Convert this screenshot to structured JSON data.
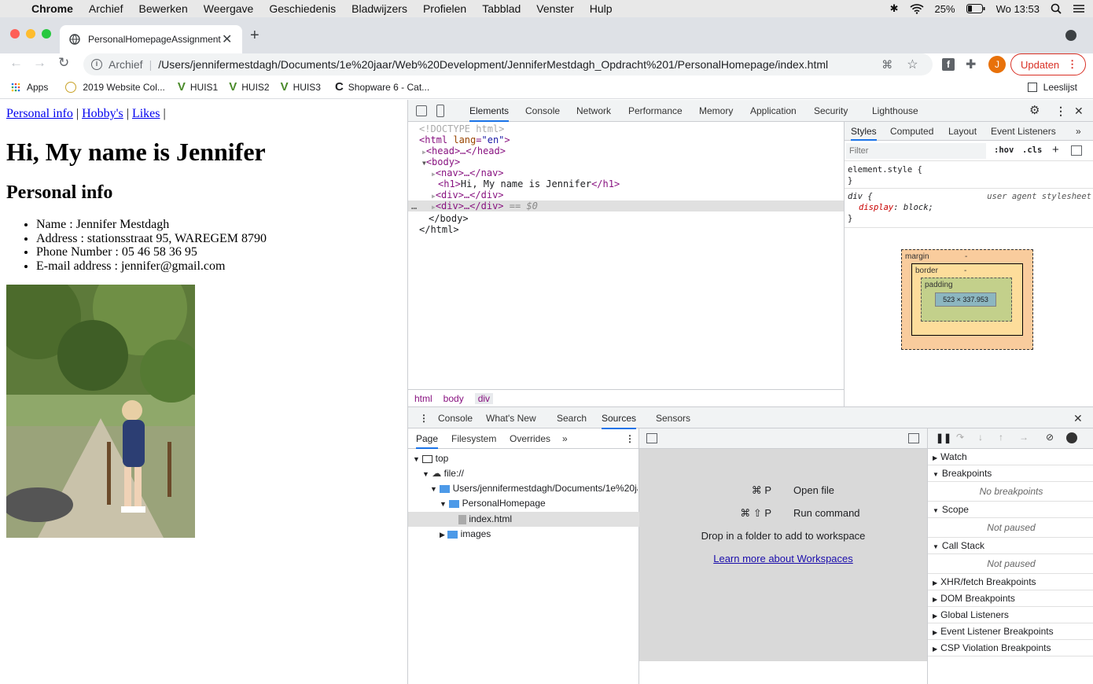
{
  "menubar": {
    "app": "Chrome",
    "items": [
      "Archief",
      "Bewerken",
      "Weergave",
      "Geschiedenis",
      "Bladwijzers",
      "Profielen",
      "Tabblad",
      "Venster",
      "Hulp"
    ],
    "battery": "25%",
    "clock": "Wo 13:53"
  },
  "tab": {
    "title": "PersonalHomepageAssignment"
  },
  "address": {
    "prefix": "Archief",
    "url": "/Users/jennifermestdagh/Documents/1e%20jaar/Web%20Development/JenniferMestdagh_Opdracht%201/PersonalHomepage/index.html"
  },
  "profile": {
    "initial": "J",
    "update_label": "Updaten"
  },
  "bookmarks": {
    "items": [
      "Apps",
      "2019 Website Col...",
      "HUIS1",
      "HUIS2",
      "HUIS3",
      "Shopware 6 - Cat..."
    ],
    "reading_list": "Leeslijst"
  },
  "page": {
    "nav": [
      {
        "label": "Personal info"
      },
      {
        "label": "Hobby's"
      },
      {
        "label": "Likes"
      }
    ],
    "separator": "|",
    "heading": "Hi, My name is Jennifer",
    "section": "Personal info",
    "info": [
      "Name : Jennifer Mestdagh",
      "Address : stationsstraat 95, WAREGEM 8790",
      "Phone Number : 05 46 58 36 95",
      "E-mail address : jennifer@gmail.com"
    ]
  },
  "devtools": {
    "tabs": [
      "Elements",
      "Console",
      "Network",
      "Performance",
      "Memory",
      "Application",
      "Security",
      "Lighthouse"
    ],
    "active_tab": "Elements",
    "dom": {
      "doctype": "<!DOCTYPE html>",
      "html_open": "<html",
      "html_attr": "lang",
      "html_val": "\"en\"",
      "head": "<head>…</head>",
      "body_open": "<body>",
      "nav": "<nav>…</nav>",
      "h1_open": "<h1>",
      "h1_text": "Hi, My name is Jennifer",
      "h1_close": "</h1>",
      "div1": "<div>…</div>",
      "div2": "<div>…</div>",
      "selected_marker": "== $0",
      "body_close": "</body>",
      "html_close": "</html>",
      "ellipsis": "…"
    },
    "breadcrumb": [
      "html",
      "body",
      "div"
    ],
    "styles": {
      "tabs": [
        "Styles",
        "Computed",
        "Layout",
        "Event Listeners"
      ],
      "filter_placeholder": "Filter",
      "hov": ":hov",
      "cls": ".cls",
      "element_style": "element.style {",
      "close_brace": "}",
      "rule_selector": "div {",
      "rule_source": "user agent stylesheet",
      "rule_prop": "display",
      "rule_val": "block;"
    },
    "boxmodel": {
      "margin": "margin",
      "border": "border",
      "padding": "padding",
      "content": "523 × 337.953",
      "dash": "-"
    },
    "drawer": {
      "tabs": [
        "Console",
        "What's New",
        "Search",
        "Sources",
        "Sensors"
      ],
      "active": "Sources"
    },
    "sources": {
      "nav_tabs": [
        "Page",
        "Filesystem",
        "Overrides"
      ],
      "tree": [
        "top",
        "file://",
        "Users/jennifermestdagh/Documents/1e%20ja",
        "PersonalHomepage",
        "index.html",
        "images"
      ],
      "shortcuts": [
        {
          "keys": "⌘ P",
          "label": "Open file"
        },
        {
          "keys": "⌘ ⇧ P",
          "label": "Run command"
        }
      ],
      "drop_text": "Drop in a folder to add to workspace",
      "learn_link": "Learn more about Workspaces",
      "debugger": {
        "sections": [
          {
            "title": "Watch",
            "expanded": false,
            "note": ""
          },
          {
            "title": "Breakpoints",
            "expanded": true,
            "note": "No breakpoints"
          },
          {
            "title": "Scope",
            "expanded": true,
            "note": "Not paused"
          },
          {
            "title": "Call Stack",
            "expanded": true,
            "note": "Not paused"
          },
          {
            "title": "XHR/fetch Breakpoints",
            "expanded": false,
            "note": ""
          },
          {
            "title": "DOM Breakpoints",
            "expanded": false,
            "note": ""
          },
          {
            "title": "Global Listeners",
            "expanded": false,
            "note": ""
          },
          {
            "title": "Event Listener Breakpoints",
            "expanded": false,
            "note": ""
          },
          {
            "title": "CSP Violation Breakpoints",
            "expanded": false,
            "note": ""
          }
        ]
      }
    }
  },
  "colors": {
    "accent": "#1a73e8",
    "update": "#d93025",
    "selection": "#e0e0e0"
  }
}
